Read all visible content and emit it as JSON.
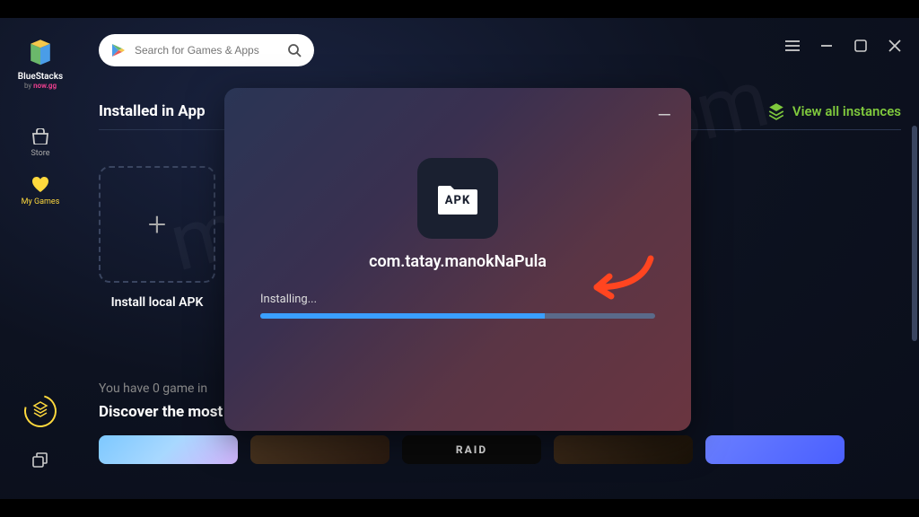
{
  "branding": {
    "name": "BlueStacks",
    "by_prefix": "by ",
    "by_brand": "now.gg"
  },
  "search": {
    "placeholder": "Search for Games & Apps"
  },
  "sidebar": {
    "store_label": "Store",
    "mygames_label": "My Games"
  },
  "section": {
    "title": "Installed in App",
    "view_all": "View all instances"
  },
  "install_tile": {
    "label": "Install local APK"
  },
  "counts": {
    "line": "You have 0 game in"
  },
  "discover": {
    "title": "Discover the most popular and exciting android games in your region"
  },
  "thumb_labels": {
    "raid": "RAID"
  },
  "modal": {
    "apk_badge": "APK",
    "package": "com.tatay.manokNaPula",
    "status": "Installing...",
    "progress_pct": 72
  },
  "watermark": "mnpmodapk.com"
}
